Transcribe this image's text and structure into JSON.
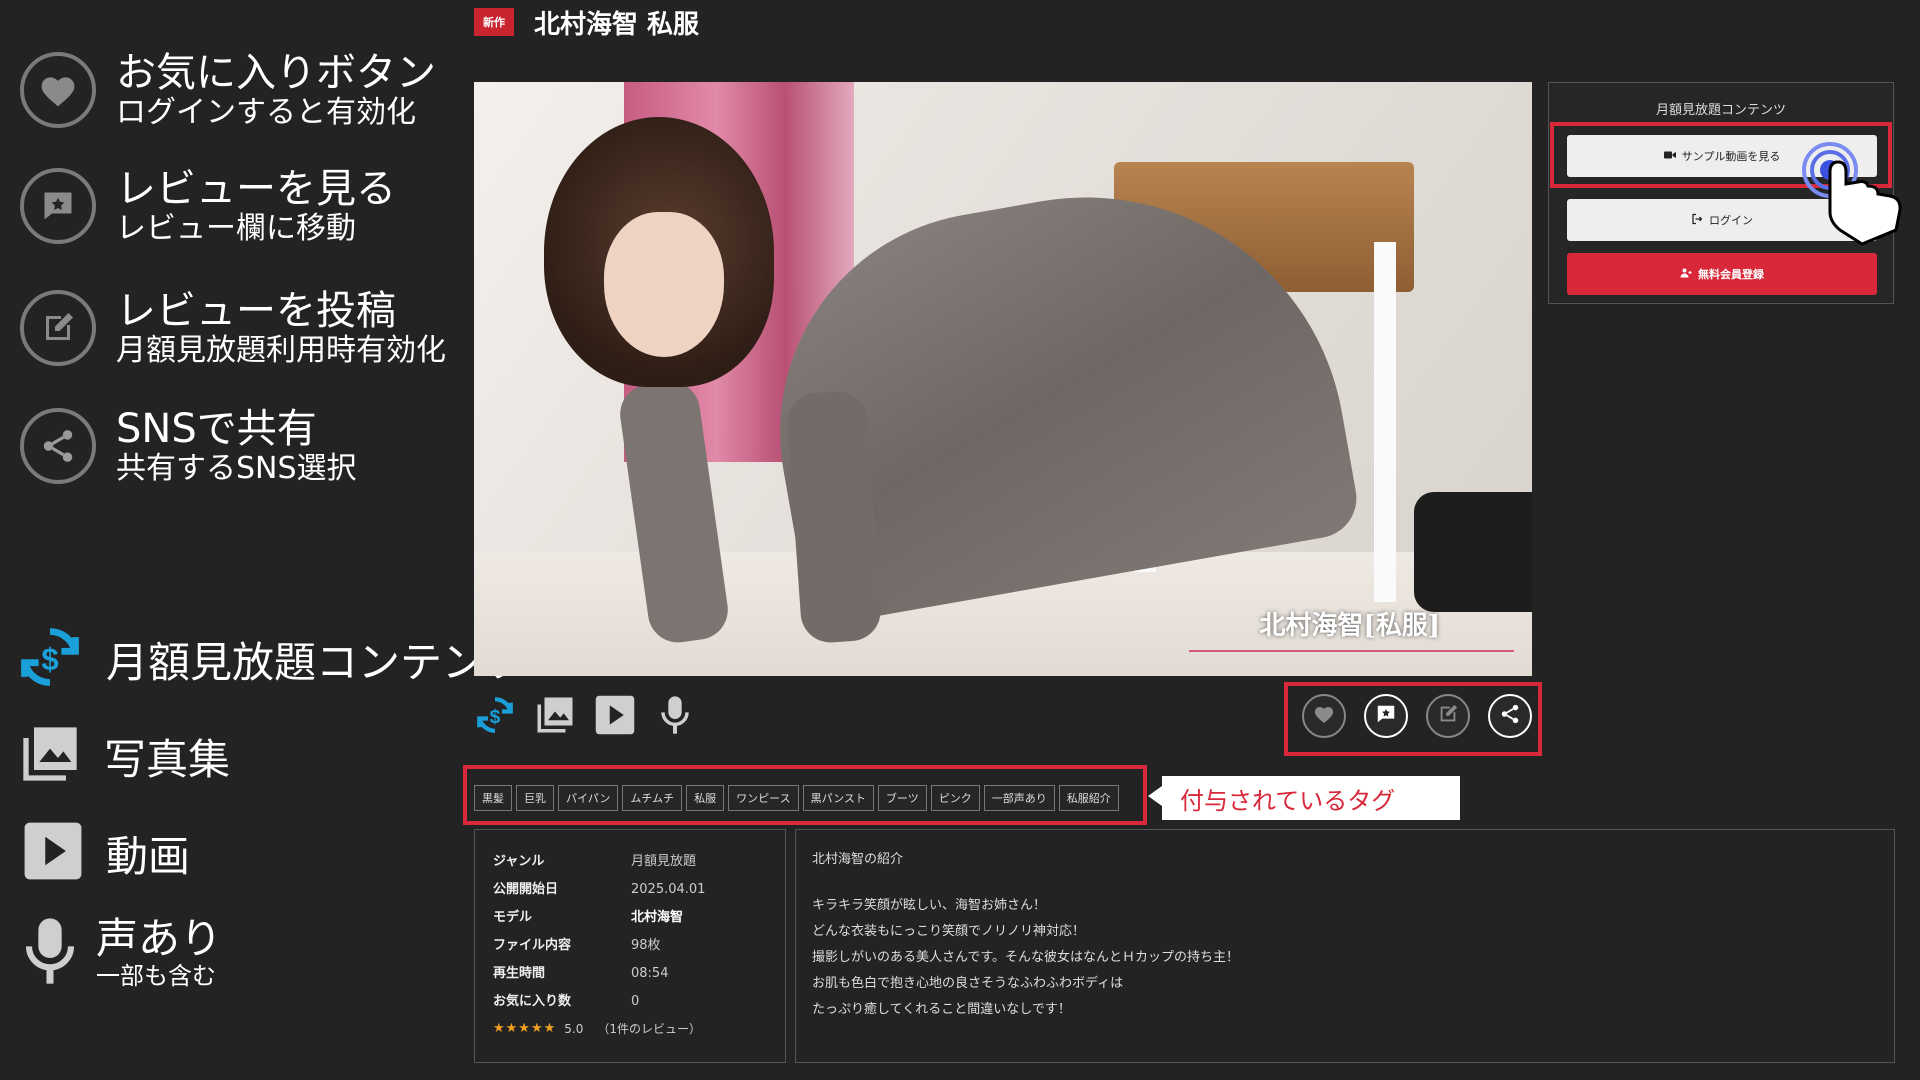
{
  "legend": {
    "favorite": {
      "main": "お気に入りボタン",
      "sub": "ログインすると有効化"
    },
    "view_review": {
      "main": "レビューを見る",
      "sub": "レビュー欄に移動"
    },
    "post_review": {
      "main": "レビューを投稿",
      "sub": "月額見放題利用時有効化"
    },
    "share": {
      "main": "SNSで共有",
      "sub": "共有するSNS選択"
    },
    "subscription": {
      "main": "月額見放題コンテンツ"
    },
    "photos": {
      "main": "写真集"
    },
    "video": {
      "main": "動画"
    },
    "voice": {
      "main": "声あり",
      "sub": "一部も含む"
    }
  },
  "header": {
    "badge": "新作",
    "title": "北村海智 私服"
  },
  "photo": {
    "caption": "北村海智[私服]"
  },
  "side_panel": {
    "title": "月額見放題コンテンツ",
    "sample_button": "サンプル動画を見る",
    "login_button": "ログイン",
    "register_button": "無料会員登録"
  },
  "tags": [
    "黒髪",
    "巨乳",
    "パイパン",
    "ムチムチ",
    "私服",
    "ワンピース",
    "黒パンスト",
    "ブーツ",
    "ピンク",
    "一部声あり",
    "私服紹介"
  ],
  "tags_callout": "付与されているタグ",
  "info": {
    "rows": [
      {
        "label": "ジャンル",
        "value": "月額見放題"
      },
      {
        "label": "公開開始日",
        "value": "2025.04.01"
      },
      {
        "label": "モデル",
        "value": "北村海智"
      },
      {
        "label": "ファイル内容",
        "value": "98枚"
      },
      {
        "label": "再生時間",
        "value": "08:54"
      },
      {
        "label": "お気に入り数",
        "value": "0"
      }
    ],
    "stars": "★★★★★",
    "rating": "5.0",
    "review_count": "（1件のレビュー）"
  },
  "description": {
    "heading": "北村海智の紹介",
    "lines": [
      "キラキラ笑顔が眩しい、海智お姉さん！",
      "どんな衣装もにっこり笑顔でノリノリ神対応！",
      "撮影しがいのある美人さんです。そんな彼女はなんとＨカップの持ち主！",
      "お肌も色白で抱き心地の良さそうなふわふわボディは",
      "たっぷり癒してくれること間違いなしです！"
    ]
  },
  "colors": {
    "accent_red": "#d8283a",
    "subscription_blue": "#1a9fd8",
    "background": "#232323"
  }
}
